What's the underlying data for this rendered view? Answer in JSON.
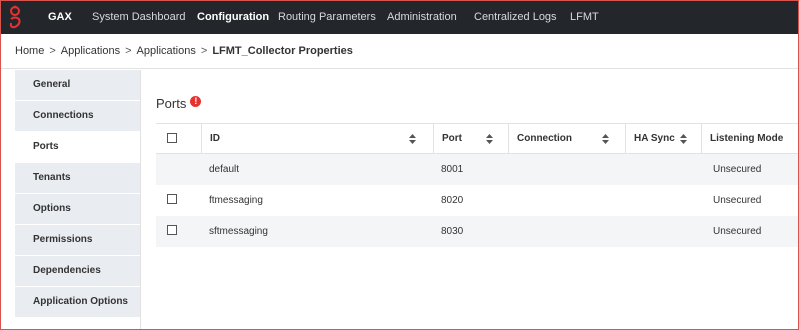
{
  "nav": {
    "brand": "GAX",
    "items": [
      {
        "label": "System Dashboard"
      },
      {
        "label": "Configuration"
      },
      {
        "label": "Routing Parameters"
      },
      {
        "label": "Administration"
      },
      {
        "label": "Centralized Logs"
      },
      {
        "label": "LFMT"
      }
    ],
    "active": "Configuration",
    "logo_icon": "genesys-logo-icon"
  },
  "breadcrumb": {
    "items": [
      "Home",
      "Applications",
      "Applications"
    ],
    "separator": ">",
    "current": "LFMT_Collector Properties"
  },
  "sidebar": {
    "items": [
      {
        "label": "General"
      },
      {
        "label": "Connections"
      },
      {
        "label": "Ports"
      },
      {
        "label": "Tenants"
      },
      {
        "label": "Options"
      },
      {
        "label": "Permissions"
      },
      {
        "label": "Dependencies"
      },
      {
        "label": "Application Options"
      }
    ],
    "active": "Ports"
  },
  "content": {
    "title": "Ports",
    "warning_icon": "!",
    "warning_color": "#e8322f"
  },
  "table": {
    "columns": [
      {
        "label": "ID",
        "sortable": true
      },
      {
        "label": "Port",
        "sortable": true
      },
      {
        "label": "Connection",
        "sortable": true
      },
      {
        "label": "HA Sync",
        "sortable": true
      },
      {
        "label": "Listening Mode",
        "sortable": false
      }
    ],
    "rows": [
      {
        "checkbox": false,
        "id": "default",
        "port": "8001",
        "connection": "",
        "ha_sync": "",
        "listening_mode": "Unsecured"
      },
      {
        "checkbox": true,
        "id": "ftmessaging",
        "port": "8020",
        "connection": "",
        "ha_sync": "",
        "listening_mode": "Unsecured"
      },
      {
        "checkbox": true,
        "id": "sftmessaging",
        "port": "8030",
        "connection": "",
        "ha_sync": "",
        "listening_mode": "Unsecured"
      }
    ]
  },
  "colors": {
    "nav_bg": "#23272b",
    "sidebar_bg": "#e9ecf0",
    "row_alt_bg": "#f4f5f6",
    "accent_red": "#e8322f"
  }
}
